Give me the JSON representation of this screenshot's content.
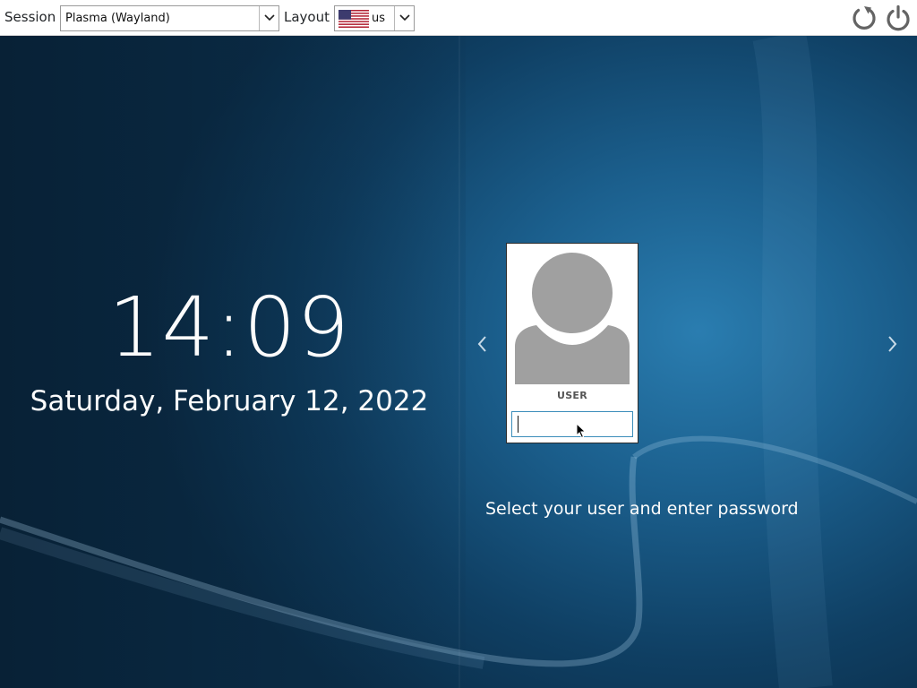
{
  "topbar": {
    "session_label": "Session",
    "session_value": "Plasma (Wayland)",
    "layout_label": "Layout",
    "layout_value": "us",
    "layout_flag": "us-flag-icon",
    "restart_icon": "restart-icon",
    "shutdown_icon": "power-icon"
  },
  "clock": {
    "time": "14:09",
    "date": "Saturday, February 12, 2022"
  },
  "login": {
    "username": "USER",
    "password_value": "",
    "avatar_icon": "user-avatar-icon",
    "hint": "Select your user and enter password",
    "prev_icon": "chevron-left-icon",
    "next_icon": "chevron-right-icon"
  },
  "colors": {
    "background_dark": "#0a2c47",
    "background_light": "#2a7db0",
    "text_light": "#fcfcfc",
    "focus_border": "#3c8dba",
    "icon_gray": "#646464"
  }
}
